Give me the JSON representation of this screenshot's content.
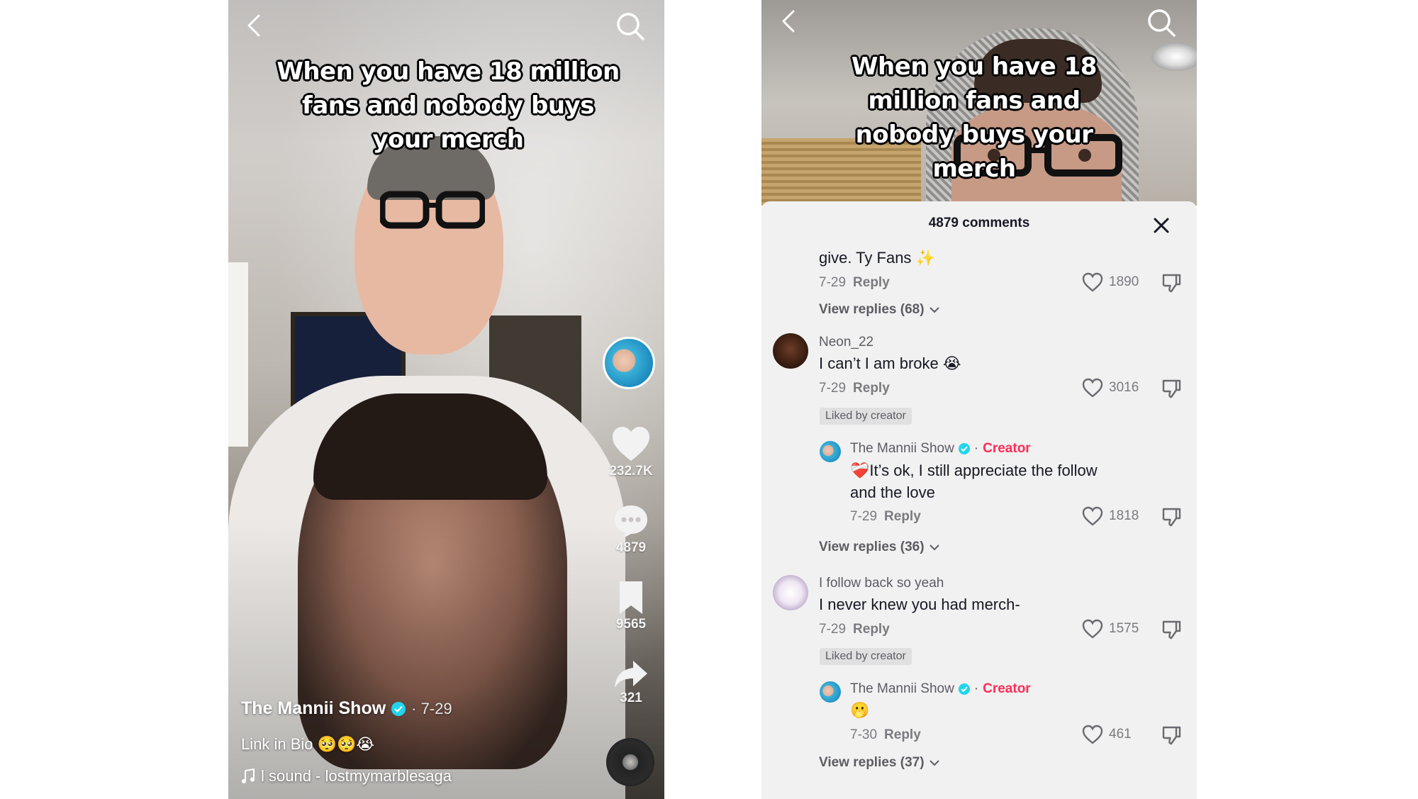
{
  "left_phone": {
    "caption": "When you have 18 million fans and nobody buys your merch",
    "side_actions": {
      "likes": "232.7K",
      "comments": "4879",
      "saves": "9565",
      "shares": "321"
    },
    "author": "The Mannii Show",
    "date": "· 7-29",
    "bio": "Link in Bio 🥺🥺😭",
    "sound": "l sound - lostmymarblesaga"
  },
  "right_phone": {
    "caption": "When you have 18 million fans and nobody buys your merch",
    "header": "4879 comments",
    "reply_label": "Reply",
    "liked_by_creator": "Liked by creator",
    "creator_label": "Creator",
    "comments": [
      {
        "text": "give. Ty Fans ✨",
        "date": "7-29",
        "likes": "1890",
        "view_replies": "View replies (68)"
      },
      {
        "user": "Neon_22",
        "text": "I can’t I am broke 😭",
        "date": "7-29",
        "likes": "3016"
      },
      {
        "user": "The Mannii Show",
        "text_line1": "❤️‍🩹It’s ok, I still appreciate the follow",
        "text_line2": "and the love",
        "date": "7-29",
        "likes": "1818",
        "view_replies": "View replies (36)"
      },
      {
        "user": "I follow back so yeah",
        "text": "I never knew you had merch-",
        "date": "7-29",
        "likes": "1575"
      },
      {
        "user": "The Mannii Show",
        "text": "🫢",
        "date": "7-30",
        "likes": "461",
        "view_replies": "View replies (37)"
      }
    ]
  },
  "colors": {
    "accent_creator": "#fe2c55",
    "verified": "#20d5ec",
    "sheet_bg": "#f1f1f1"
  },
  "icons": [
    "back-chevron-icon",
    "search-icon",
    "heart-icon",
    "comment-bubble-icon",
    "bookmark-icon",
    "share-arrow-icon",
    "music-note-icon",
    "close-icon",
    "dislike-icon",
    "verified-badge-icon",
    "chevron-down-icon"
  ]
}
